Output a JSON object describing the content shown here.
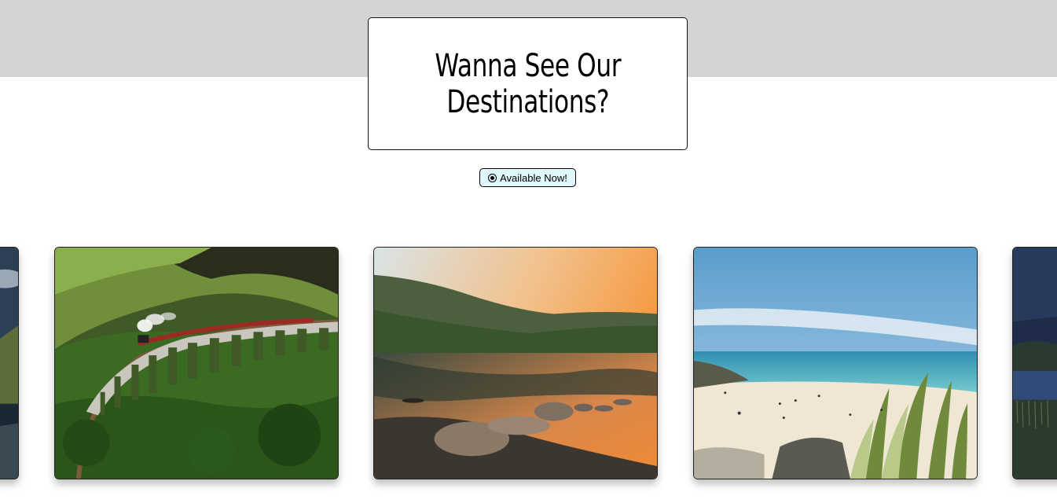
{
  "hero": {
    "title_line1": "Wanna See Our",
    "title_line2": "Destinations?"
  },
  "status": {
    "label": "Available Now!",
    "icon": "radio-selected-icon"
  },
  "colors": {
    "top_band": "#d4d4d4",
    "pill_background": "#dff6fb"
  },
  "destinations": [
    {
      "name": "lake-night"
    },
    {
      "name": "viaduct-train"
    },
    {
      "name": "lake-sunset"
    },
    {
      "name": "beach"
    },
    {
      "name": "lake-dusk"
    }
  ]
}
